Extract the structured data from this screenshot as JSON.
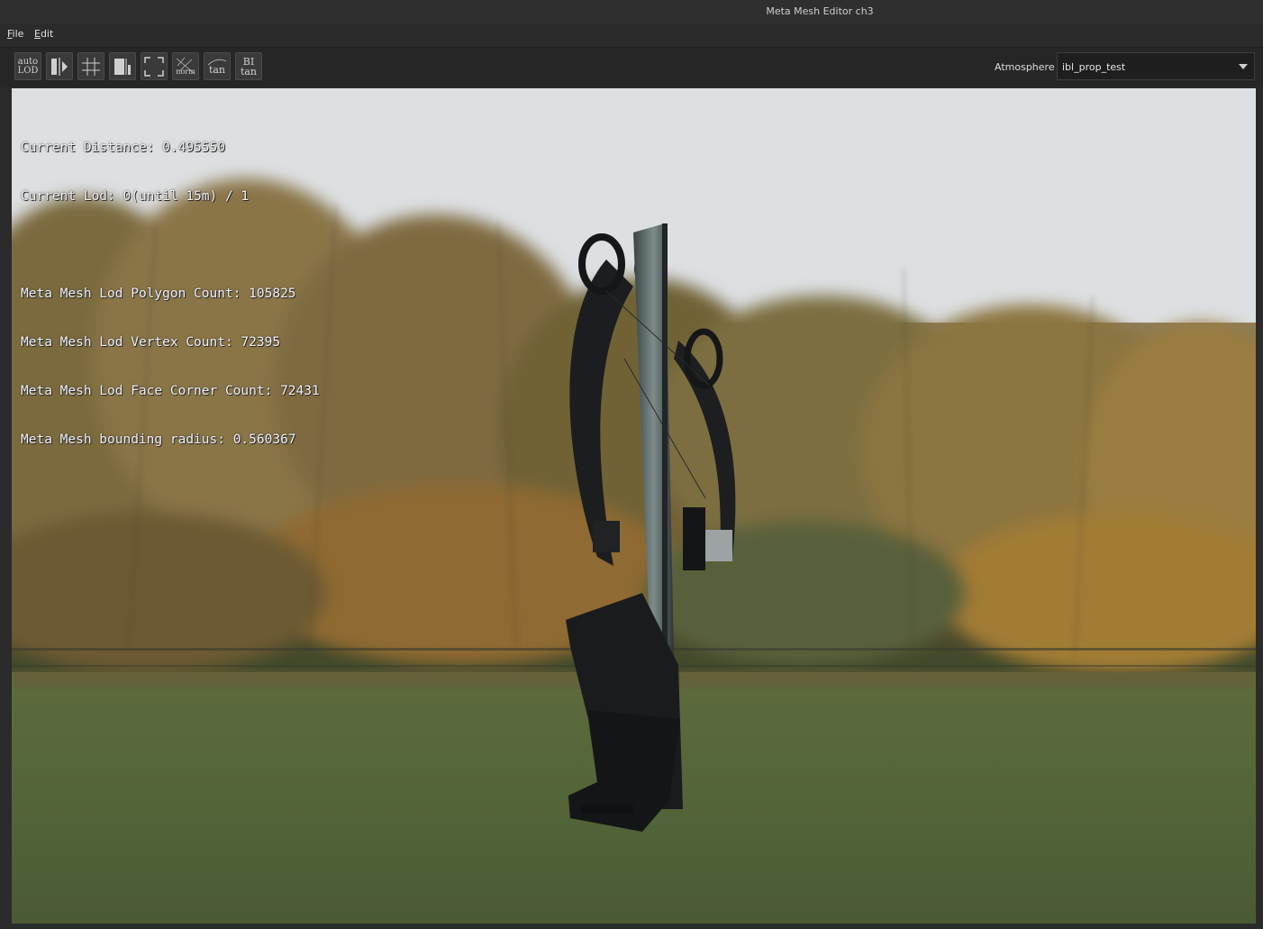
{
  "window": {
    "title": "Meta Mesh Editor ch3"
  },
  "menu": {
    "file": "File",
    "file_rest": "ile",
    "file_key": "F",
    "edit_key": "E",
    "edit_rest": "dit"
  },
  "toolbar": {
    "auto_lod": "auto\nLOD",
    "norm": "norm",
    "tan": "tan",
    "bitan": "BI\ntan"
  },
  "atmosphere": {
    "label": "Atmosphere",
    "value": "ibl_prop_test"
  },
  "stats": {
    "current_distance": "Current Distance: 0.495550",
    "current_lod": "Current Lod: 0(until 15m) / 1",
    "polygon_count": "Meta Mesh Lod Polygon Count: 105825",
    "vertex_count": "Meta Mesh Lod Vertex Count: 72395",
    "face_corner_count": "Meta Mesh Lod Face Corner Count: 72431",
    "bounding_radius": "Meta Mesh bounding radius: 0.560367"
  },
  "colors": {
    "accent": "#3a3a3a",
    "panel": "#262626",
    "titlebar": "#2f2f2f"
  }
}
